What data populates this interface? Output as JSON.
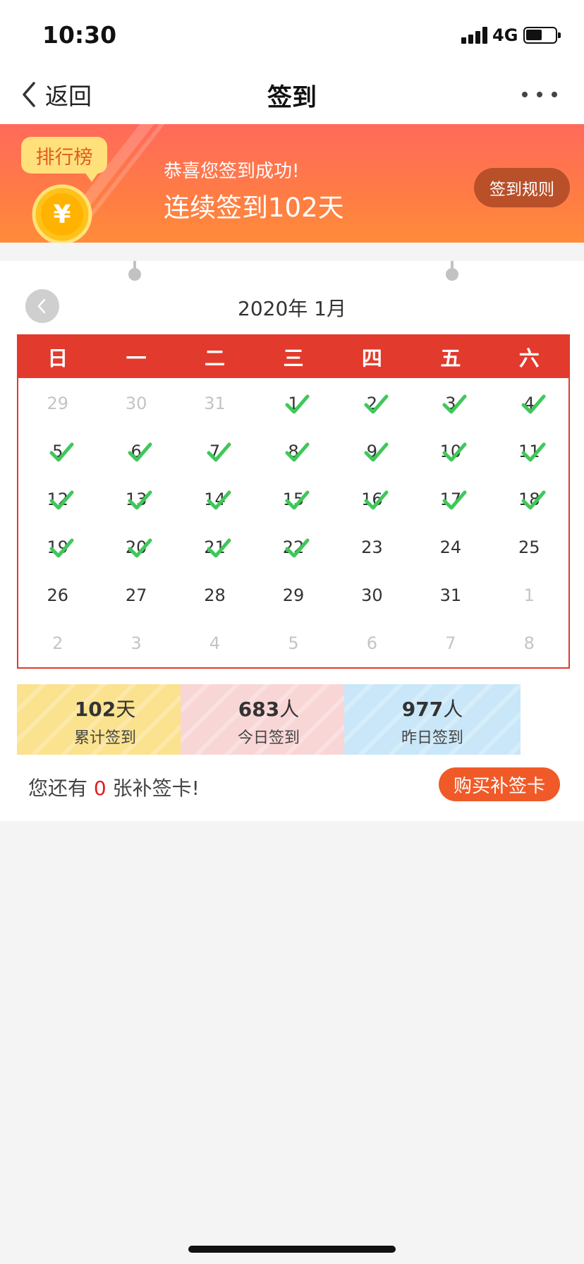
{
  "status_bar": {
    "time": "10:30",
    "network": "4G",
    "battery_level": 0.55
  },
  "nav": {
    "back_label": "返回",
    "title": "签到"
  },
  "banner": {
    "rank_label": "排行榜",
    "coin_symbol": "¥",
    "subtitle": "恭喜您签到成功!",
    "streak_text": "连续签到102天",
    "rules_label": "签到规则"
  },
  "calendar": {
    "month_title": "2020年 1月",
    "weekdays": [
      "日",
      "一",
      "二",
      "三",
      "四",
      "五",
      "六"
    ],
    "days": [
      {
        "label": "29",
        "current": false,
        "signed": false
      },
      {
        "label": "30",
        "current": false,
        "signed": false
      },
      {
        "label": "31",
        "current": false,
        "signed": false
      },
      {
        "label": "1",
        "current": true,
        "signed": true
      },
      {
        "label": "2",
        "current": true,
        "signed": true
      },
      {
        "label": "3",
        "current": true,
        "signed": true
      },
      {
        "label": "4",
        "current": true,
        "signed": true
      },
      {
        "label": "5",
        "current": true,
        "signed": true
      },
      {
        "label": "6",
        "current": true,
        "signed": true
      },
      {
        "label": "7",
        "current": true,
        "signed": true
      },
      {
        "label": "8",
        "current": true,
        "signed": true
      },
      {
        "label": "9",
        "current": true,
        "signed": true
      },
      {
        "label": "10",
        "current": true,
        "signed": true
      },
      {
        "label": "11",
        "current": true,
        "signed": true
      },
      {
        "label": "12",
        "current": true,
        "signed": true
      },
      {
        "label": "13",
        "current": true,
        "signed": true
      },
      {
        "label": "14",
        "current": true,
        "signed": true
      },
      {
        "label": "15",
        "current": true,
        "signed": true
      },
      {
        "label": "16",
        "current": true,
        "signed": true
      },
      {
        "label": "17",
        "current": true,
        "signed": true
      },
      {
        "label": "18",
        "current": true,
        "signed": true
      },
      {
        "label": "19",
        "current": true,
        "signed": true
      },
      {
        "label": "20",
        "current": true,
        "signed": true
      },
      {
        "label": "21",
        "current": true,
        "signed": true
      },
      {
        "label": "22",
        "current": true,
        "signed": true
      },
      {
        "label": "23",
        "current": true,
        "signed": false
      },
      {
        "label": "24",
        "current": true,
        "signed": false
      },
      {
        "label": "25",
        "current": true,
        "signed": false
      },
      {
        "label": "26",
        "current": true,
        "signed": false
      },
      {
        "label": "27",
        "current": true,
        "signed": false
      },
      {
        "label": "28",
        "current": true,
        "signed": false
      },
      {
        "label": "29",
        "current": true,
        "signed": false
      },
      {
        "label": "30",
        "current": true,
        "signed": false
      },
      {
        "label": "31",
        "current": true,
        "signed": false
      },
      {
        "label": "1",
        "current": false,
        "signed": false
      },
      {
        "label": "2",
        "current": false,
        "signed": false
      },
      {
        "label": "3",
        "current": false,
        "signed": false
      },
      {
        "label": "4",
        "current": false,
        "signed": false
      },
      {
        "label": "5",
        "current": false,
        "signed": false
      },
      {
        "label": "6",
        "current": false,
        "signed": false
      },
      {
        "label": "7",
        "current": false,
        "signed": false
      },
      {
        "label": "8",
        "current": false,
        "signed": false
      }
    ]
  },
  "stats": [
    {
      "value": "102",
      "unit": "天",
      "label": "累计签到",
      "color": "#fbe28e"
    },
    {
      "value": "683",
      "unit": "人",
      "label": "今日签到",
      "color": "#f9d6d6"
    },
    {
      "value": "977",
      "unit": "人",
      "label": "昨日签到",
      "color": "#c9e7f8"
    }
  ],
  "makeup": {
    "prefix": "您还有",
    "count": "0",
    "suffix": "张补签卡!",
    "buy_label": "购买补签卡"
  },
  "colors": {
    "accent_red": "#e23a2c",
    "check_green": "#3fc85a",
    "banner_orange": "#ff7c45",
    "buy_button": "#f05a28"
  }
}
